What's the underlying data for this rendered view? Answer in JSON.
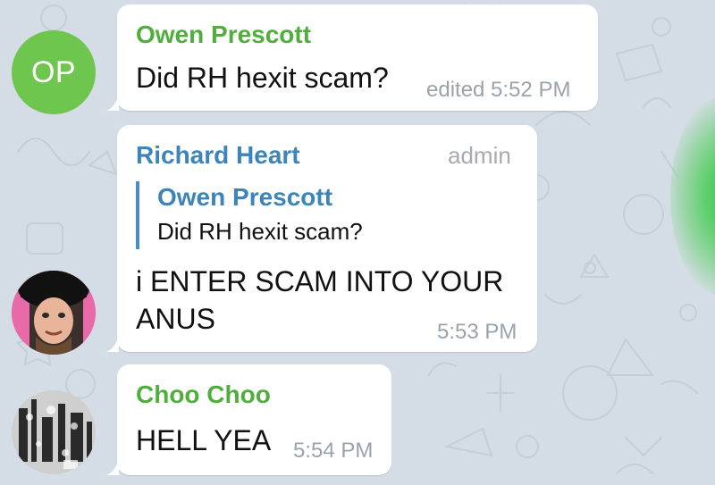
{
  "messages": [
    {
      "sender": "Owen Prescott",
      "avatar_initials": "OP",
      "text": "Did RH hexit scam?",
      "time": "edited 5:52 PM"
    },
    {
      "sender": "Richard Heart",
      "badge": "admin",
      "reply": {
        "sender": "Owen Prescott",
        "text": "Did RH hexit scam?"
      },
      "text_line1": "i ENTER SCAM INTO YOUR",
      "text_line2": "ANUS",
      "time": "5:53 PM"
    },
    {
      "sender": "Choo Choo",
      "text": "HELL YEA",
      "time": "5:54 PM"
    }
  ],
  "colors": {
    "background": "#d4dde5",
    "sender_green": "#4fae3c",
    "sender_blue": "#3d84b8",
    "avatar_green": "#6fc64f"
  }
}
